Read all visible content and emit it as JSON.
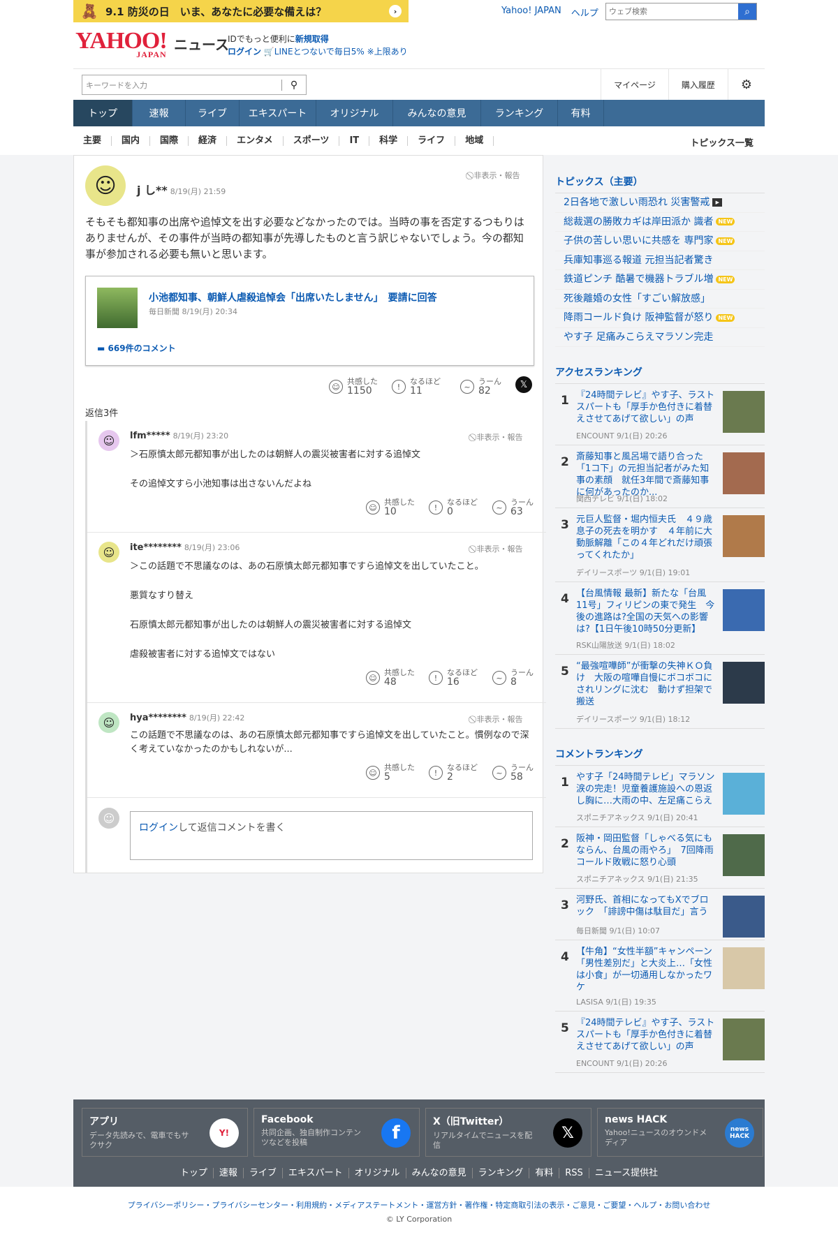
{
  "banner": {
    "icon": "kids-character-icon",
    "text": "9.1 防災の日　いま、あなたに必要な備えは？",
    "arrow": "›"
  },
  "header": {
    "links": [
      "Yahoo! JAPAN",
      "ヘルプ"
    ],
    "web_search_placeholder": "ウェブ検索",
    "logo": "YAHOO!",
    "logo_sub": "JAPAN",
    "logo_news": "ニュース",
    "id_line1_prefix": "IDでもっと便利に",
    "id_line1_link": "新規取得",
    "id_line2_login": "ログイン",
    "id_line2_line": "LINEとつないで毎日5% ※上限あり"
  },
  "search": {
    "placeholder": "キーワードを入力",
    "mypage": "マイページ",
    "history": "購入履歴"
  },
  "nav": {
    "tabs": [
      "トップ",
      "速報",
      "ライブ",
      "エキスパート",
      "オリジナル",
      "みんなの意見",
      "ランキング",
      "有料"
    ]
  },
  "subnav": {
    "items": [
      "主要",
      "国内",
      "国際",
      "経済",
      "エンタメ",
      "スポーツ",
      "IT",
      "科学",
      "ライフ",
      "地域"
    ],
    "topics": "トピックス一覧"
  },
  "comment": {
    "user": "j し**",
    "date": "8/19(月) 21:59",
    "hide": "非表示・報告",
    "body": "そもそも都知事の出席や追悼文を出す必要などなかったのでは。当時の事を否定するつもりはありませんが、その事件が当時の都知事が先導したものと言う訳じゃないでしょう。今の都知事が参加される必要も無いと思います。",
    "article": {
      "title": "小池都知事、朝鮮人虐殺追悼会「出席いたしません」　要請に回答",
      "source": "毎日新聞 8/19(月) 20:34",
      "comments": "669件のコメント"
    },
    "reactions": [
      {
        "label": "共感した",
        "count": "1150"
      },
      {
        "label": "なるほど",
        "count": "11"
      },
      {
        "label": "うーん",
        "count": "82"
      }
    ],
    "replies_label": "返信3件"
  },
  "replies": [
    {
      "user": "lfm*****",
      "date": "8/19(月) 23:20",
      "hide": "非表示・報告",
      "paras": [
        "＞石原慎太郎元都知事が出したのは朝鮮人の震災被害者に対する追悼文",
        "その追悼文すら小池知事は出さないんだよね"
      ],
      "reactions": [
        {
          "label": "共感した",
          "count": "10"
        },
        {
          "label": "なるほど",
          "count": "0"
        },
        {
          "label": "うーん",
          "count": "63"
        }
      ]
    },
    {
      "user": "ite********",
      "date": "8/19(月) 23:06",
      "hide": "非表示・報告",
      "paras": [
        "＞この話題で不思議なのは、あの石原慎太郎元都知事ですら追悼文を出していたこと。",
        "悪質なすり替え",
        "石原慎太郎元都知事が出したのは朝鮮人の震災被害者に対する追悼文",
        "虐殺被害者に対する追悼文ではない"
      ],
      "reactions": [
        {
          "label": "共感した",
          "count": "48"
        },
        {
          "label": "なるほど",
          "count": "16"
        },
        {
          "label": "うーん",
          "count": "8"
        }
      ]
    },
    {
      "user": "hya********",
      "date": "8/19(月) 22:42",
      "hide": "非表示・報告",
      "paras": [
        "この話題で不思議なのは、あの石原慎太郎元都知事ですら追悼文を出していたこと。慣例なので深く考えていなかったのかもしれないが..."
      ],
      "reactions": [
        {
          "label": "共感した",
          "count": "5"
        },
        {
          "label": "なるほど",
          "count": "2"
        },
        {
          "label": "うーん",
          "count": "58"
        }
      ]
    }
  ],
  "reply_input": {
    "login": "ログイン",
    "rest": "して返信コメントを書く"
  },
  "sidebar": {
    "topics_title": "トピックス（主要）",
    "topics": [
      {
        "text": "2日各地で激しい雨恐れ 災害警戒",
        "badge": "video"
      },
      {
        "text": "総裁選の勝敗カギは岸田派か 識者",
        "badge": "NEW"
      },
      {
        "text": "子供の苦しい思いに共感を 専門家",
        "badge": "NEW"
      },
      {
        "text": "兵庫知事巡る報道 元担当記者驚き",
        "badge": ""
      },
      {
        "text": "鉄道ピンチ 酷暑で機器トラブル増",
        "badge": "NEW"
      },
      {
        "text": "死後離婚の女性「すごい解放感」",
        "badge": ""
      },
      {
        "text": "降雨コールド負け 阪神監督が怒り",
        "badge": "NEW"
      },
      {
        "text": "やす子 足痛みこらえマラソン完走",
        "badge": ""
      }
    ],
    "access_title": "アクセスランキング",
    "access": [
      {
        "num": "1",
        "title": "『24時間テレビ』やす子、ラストスパートも「厚手か色付きに着替えさせてあげて欲しい」の声",
        "src": "ENCOUNT 9/1(日) 20:26"
      },
      {
        "num": "2",
        "title": "斎藤知事と風呂場で語り合った「1コ下」の元担当記者がみた知事の素顔　就任3年間で斎藤知事に何があったのか...",
        "src": "関西テレビ 9/1(日) 18:02"
      },
      {
        "num": "3",
        "title": "元巨人監督・堀内恒夫氏　４９歳息子の死去を明かす　４年前に大動脈解離「この４年どれだけ頑張ってくれたか」",
        "src": "デイリースポーツ 9/1(日) 19:01"
      },
      {
        "num": "4",
        "title": "【台風情報 最新】新たな「台風11号」フィリピンの東で発生　今後の進路は?全国の天気への影響は?【1日午後10時50分更新】",
        "src": "RSK山陽放送 9/1(日) 18:02"
      },
      {
        "num": "5",
        "title": "“最強喧嘩師”が衝撃の失神ＫＯ負け　大阪の喧嘩自慢にボコボコにされリングに沈む　動けず担架で搬送",
        "src": "デイリースポーツ 9/1(日) 18:12"
      }
    ],
    "comment_title": "コメントランキング",
    "comment_rank": [
      {
        "num": "1",
        "title": "やす子「24時間テレビ」マラソン涙の完走！児童養護施設への恩返し胸に…大雨の中、左足痛こらえ",
        "src": "スポニチアネックス 9/1(日) 20:41"
      },
      {
        "num": "2",
        "title": "阪神・岡田監督「しゃべる気にもならん、台風の雨やろ」　7回降雨コールド敗戦に怒り心頭",
        "src": "スポニチアネックス 9/1(日) 21:35"
      },
      {
        "num": "3",
        "title": "河野氏、首相になってもXでブロック　「誹謗中傷は駄目だ」言う",
        "src": "毎日新聞 9/1(日) 10:07"
      },
      {
        "num": "4",
        "title": "【牛角】“女性半額”キャンペーン「男性差別だ」と大炎上…「女性は小食」が一切通用しなかったワケ",
        "src": "LASISA 9/1(日) 19:35"
      },
      {
        "num": "5",
        "title": "『24時間テレビ』やす子、ラストスパートも「厚手か色付きに着替えさせてあげて欲しい」の声",
        "src": "ENCOUNT 9/1(日) 20:26"
      }
    ]
  },
  "footer": {
    "boxes": [
      {
        "title": "アプリ",
        "desc": "データ先読みで、電車でもサクサク",
        "icon": "yahoo-app-icon",
        "glyph": "Y!"
      },
      {
        "title": "Facebook",
        "desc": "共同企画、独自制作コンテンツなどを投稿",
        "icon": "facebook-icon",
        "glyph": "f"
      },
      {
        "title": "X（旧Twitter）",
        "desc": "リアルタイムでニュースを配信",
        "icon": "x-icon",
        "glyph": "𝕏"
      },
      {
        "title": "news HACK",
        "desc": "Yahoo!ニュースのオウンドメディア",
        "icon": "news-hack-icon",
        "glyph": "news HACK"
      }
    ],
    "links": [
      "トップ",
      "速報",
      "ライブ",
      "エキスパート",
      "オリジナル",
      "みんなの意見",
      "ランキング",
      "有料",
      "RSS",
      "ニュース提供社"
    ],
    "bottom_links": "プライバシーポリシー・プライバシーセンター・利用規約・メディアステートメント・運営方針・著作権・特定商取引法の表示・ご意見・ご要望・ヘルプ・お問い合わせ",
    "copyright": "© LY Corporation"
  }
}
